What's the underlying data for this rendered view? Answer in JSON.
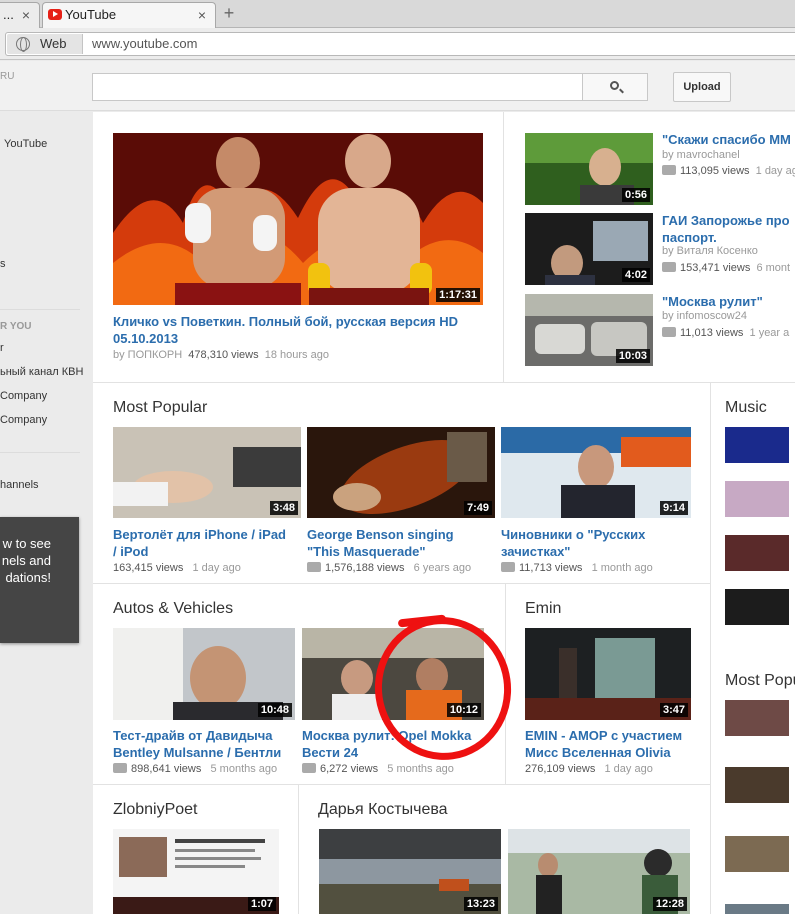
{
  "browser": {
    "tab_first_label": "...",
    "tab_active_label": "YouTube",
    "tab_close_glyph": "×",
    "new_tab_glyph": "+",
    "address_mode": "Web",
    "url": "www.youtube.com"
  },
  "masthead": {
    "region": "RU",
    "search_value": "",
    "upload_label": "Upload"
  },
  "guide": {
    "items": [
      {
        "label": "YouTube"
      },
      {
        "label": "s"
      }
    ],
    "heading_for_you": "R YOU",
    "subscriptions": [
      {
        "label": "r"
      },
      {
        "label": "ьный канал КВН"
      },
      {
        "label": "Company"
      },
      {
        "label": "Company"
      }
    ],
    "channels_label": "hannels",
    "promo_text": "w to see\nnels and\ndations!"
  },
  "featured": {
    "title": "Кличко vs Поветкин. Полный бой, русская версия HD 05.10.2013",
    "by": "by ПОПКОРН",
    "views": "478,310 views",
    "age": "18 hours ago",
    "duration": "1:17:31"
  },
  "side_videos": [
    {
      "title": "\"Скажи спасибо ММ",
      "by": "by mavrochanel",
      "views": "113,095 views",
      "age": "1 day ago",
      "duration": "0:56"
    },
    {
      "title": "ГАИ Запорожье про паспорт.",
      "by": "by Виталя Косенко",
      "views": "153,471 views",
      "age": "6 mont",
      "duration": "4:02"
    },
    {
      "title": "\"Москва рулит\"",
      "by": "by infomoscow24",
      "views": "11,013 views",
      "age": "1 year a",
      "duration": "10:03"
    }
  ],
  "most_popular": {
    "title": "Most Popular",
    "videos": [
      {
        "title": "Вертолёт для iPhone / iPad / iPod",
        "views": "163,415 views",
        "age": "1 day ago",
        "duration": "3:48"
      },
      {
        "title": "George Benson singing \"This Masquerade\"",
        "views": "1,576,188 views",
        "age": "6 years ago",
        "duration": "7:49"
      },
      {
        "title": "Чиновники о \"Русских зачистках\"",
        "views": "11,713 views",
        "age": "1 month ago",
        "duration": "9:14"
      }
    ]
  },
  "autos": {
    "title": "Autos & Vehicles",
    "videos": [
      {
        "title": "Тест-драйв от Давидыча Bentley Mulsanne / Бентли",
        "views": "898,641 views",
        "age": "5 months ago",
        "duration": "10:48"
      },
      {
        "title": "Москва рулит: Opel Mokka Вести 24",
        "views": "6,272 views",
        "age": "5 months ago",
        "duration": "10:12"
      }
    ]
  },
  "emin": {
    "title": "Emin",
    "video": {
      "title": "EMIN - AMOP с участием Мисс Вселенная Olivia",
      "views": "276,109 views",
      "age": "1 day ago",
      "duration": "3:47"
    }
  },
  "zlobniy": {
    "title": "ZlobniyPoet",
    "duration": "1:07"
  },
  "darya": {
    "title": "Дарья Костычева",
    "durations": [
      "13:23",
      "12:28"
    ]
  },
  "right_column": {
    "music_title": "Music",
    "most_popular_title": "Most Popu"
  }
}
